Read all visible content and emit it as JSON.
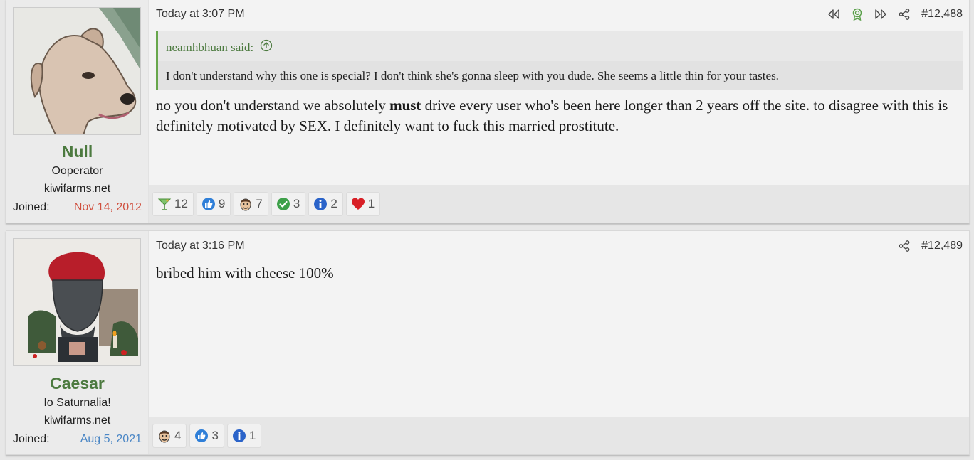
{
  "posts": [
    {
      "user": {
        "name": "Null",
        "title": "Ooperator",
        "domain": "kiwifarms.net",
        "joined_label": "Joined:",
        "joined_date": "Nov 14, 2012",
        "joined_color": "#d0503f",
        "avatar": "dog-avatar"
      },
      "date": "Today at 3:07 PM",
      "number": "#12,488",
      "actions": [
        "rewind-icon",
        "award-icon",
        "fast-forward-icon",
        "share-icon"
      ],
      "quote": {
        "author": "neamhbhuan said:",
        "text": "I don't understand why this one is special? I don't think she's gonna sleep with you dude. She seems a little thin for your tastes."
      },
      "body": {
        "before": "no you don't understand we absolutely ",
        "bold": "must",
        "after": " drive every user who's been here longer than 2 years off the site. to disagree with this is definitely motivated by SEX. I definitely want to fuck this married prostitute."
      },
      "reactions": [
        {
          "icon": "cocktail-icon",
          "count": "12"
        },
        {
          "icon": "thumbs-up-icon",
          "count": "9"
        },
        {
          "icon": "face-icon",
          "count": "7"
        },
        {
          "icon": "checkmark-icon",
          "count": "3"
        },
        {
          "icon": "info-icon",
          "count": "2"
        },
        {
          "icon": "heart-icon",
          "count": "1"
        }
      ]
    },
    {
      "user": {
        "name": "Caesar",
        "title": "Io Saturnalia!",
        "domain": "kiwifarms.net",
        "joined_label": "Joined:",
        "joined_date": "Aug 5, 2021",
        "joined_color": "#4a86c5",
        "avatar": "bust-avatar"
      },
      "date": "Today at 3:16 PM",
      "number": "#12,489",
      "actions": [
        "share-icon"
      ],
      "body": {
        "before": "bribed him with cheese 100%"
      },
      "reactions": [
        {
          "icon": "face-icon",
          "count": "4"
        },
        {
          "icon": "thumbs-up-icon",
          "count": "3"
        },
        {
          "icon": "info-icon",
          "count": "1"
        }
      ]
    }
  ]
}
